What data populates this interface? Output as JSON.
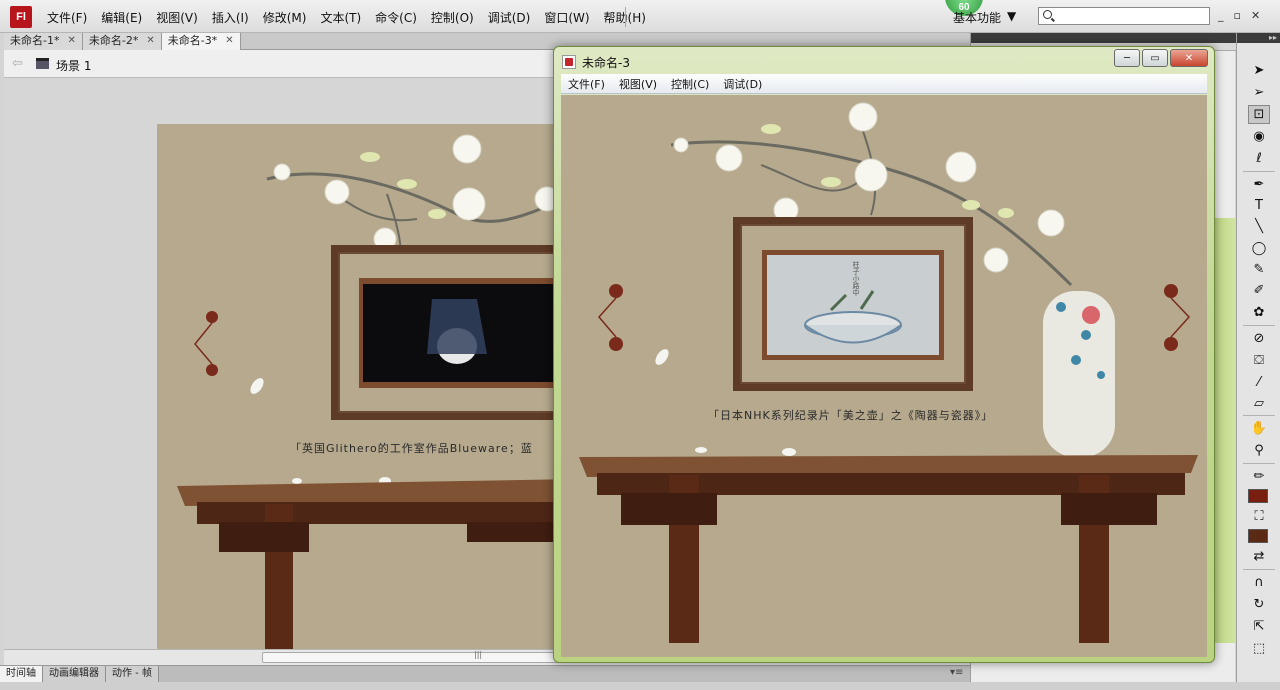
{
  "app": {
    "logo": "Fl",
    "menu": [
      "文件(F)",
      "编辑(E)",
      "视图(V)",
      "插入(I)",
      "修改(M)",
      "文本(T)",
      "命令(C)",
      "控制(O)",
      "调试(D)",
      "窗口(W)",
      "帮助(H)"
    ],
    "fps_badge": "60",
    "workspace": "基本功能",
    "workspace_arrow": "▼",
    "search_placeholder": "",
    "window_controls": [
      "_",
      "▫",
      "✕"
    ]
  },
  "doc_tabs": [
    {
      "label": "未命名-1*",
      "close": "✕",
      "active": false
    },
    {
      "label": "未命名-2*",
      "close": "✕",
      "active": false
    },
    {
      "label": "未命名-3*",
      "close": "✕",
      "active": true
    }
  ],
  "scene": {
    "label": "场景 1"
  },
  "stage": {
    "caption": "「英国Glithero的工作室作品Blueware；蓝",
    "background": "#b6a98e"
  },
  "player": {
    "title": "未命名-3",
    "menu": [
      "文件(F)",
      "视图(V)",
      "控制(C)",
      "调试(D)"
    ],
    "buttons": [
      "─",
      "▭",
      "✕"
    ],
    "caption": "「日本NHK系列纪录片「美之壶」之《陶器与瓷器》」",
    "vertical_text": "柱子小路中"
  },
  "bottom_tabs": [
    "时间轴",
    "动画编辑器",
    "动作 - 帧"
  ],
  "panel_menu": "▾≡",
  "scroll_grip": "|||",
  "colors": {
    "stroke_color": "#7a1e10",
    "fill_color": "#5a2a14",
    "wall": "#b6a98e",
    "brand": "#b8141b"
  }
}
